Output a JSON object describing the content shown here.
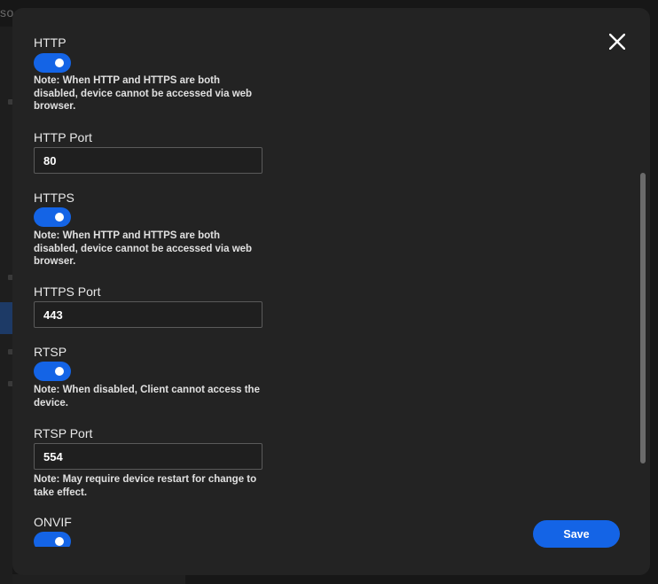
{
  "background": {
    "title_fragment": "so",
    "title_suffix": "..."
  },
  "dialog": {
    "close_icon": "close-icon",
    "save_label": "Save",
    "accent_color": "#1464e6",
    "sections": {
      "http": {
        "label": "HTTP",
        "enabled": true,
        "note": "Note: When HTTP and HTTPS are both disabled, device cannot be accessed via web browser."
      },
      "http_port": {
        "label": "HTTP Port",
        "value": "80"
      },
      "https": {
        "label": "HTTPS",
        "enabled": true,
        "note": "Note: When HTTP and HTTPS are both disabled, device cannot be accessed via web browser."
      },
      "https_port": {
        "label": "HTTPS Port",
        "value": "443"
      },
      "rtsp": {
        "label": "RTSP",
        "enabled": true,
        "note": "Note: When disabled, Client cannot access the device."
      },
      "rtsp_port": {
        "label": "RTSP Port",
        "value": "554",
        "note": "Note: May require device restart for change to take effect."
      },
      "onvif": {
        "label": "ONVIF",
        "enabled": true
      }
    }
  }
}
